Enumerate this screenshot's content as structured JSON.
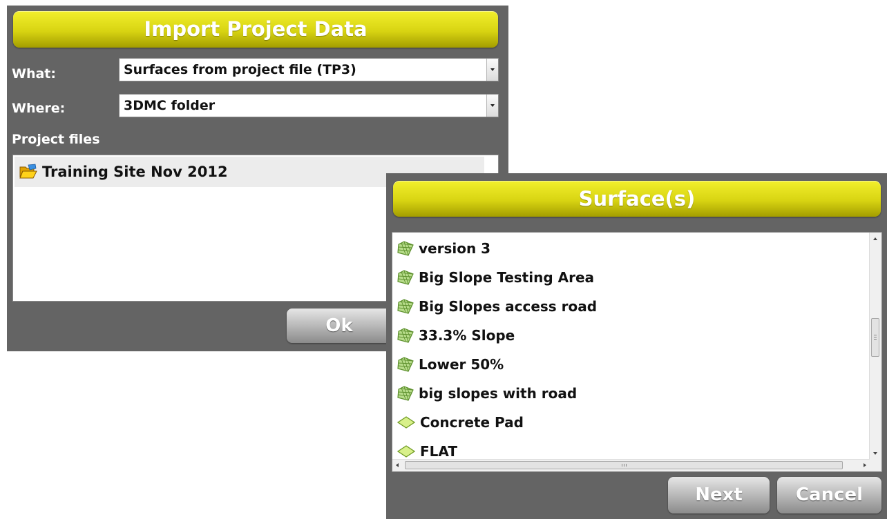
{
  "import_dialog": {
    "title": "Import Project Data",
    "what_label": "What:",
    "what_value": "Surfaces from project file (TP3)",
    "where_label": "Where:",
    "where_value": "3DMC folder",
    "project_files_label": "Project files",
    "project_files": [
      {
        "icon": "open-folder-icon",
        "name": "Training Site Nov 2012",
        "selected": true
      }
    ],
    "ok_label": "Ok"
  },
  "surfaces_dialog": {
    "title": "Surface(s)",
    "surfaces": [
      {
        "icon": "surface-mesh-icon",
        "name": "version 3"
      },
      {
        "icon": "surface-mesh-icon",
        "name": "Big Slope Testing Area"
      },
      {
        "icon": "surface-mesh-icon",
        "name": "Big Slopes access road"
      },
      {
        "icon": "surface-mesh-icon",
        "name": "33.3% Slope"
      },
      {
        "icon": "surface-mesh-icon",
        "name": "Lower 50%"
      },
      {
        "icon": "surface-mesh-icon",
        "name": "big slopes with road"
      },
      {
        "icon": "plane-surface-icon",
        "name": "Concrete Pad"
      },
      {
        "icon": "plane-surface-icon",
        "name": "FLAT"
      }
    ],
    "next_label": "Next",
    "cancel_label": "Cancel"
  },
  "colors": {
    "panel_bg": "#646464",
    "title_bar_yellow": "#e0dc14",
    "selected_row": "#ececec",
    "button_grey": "#b0b0b0"
  }
}
